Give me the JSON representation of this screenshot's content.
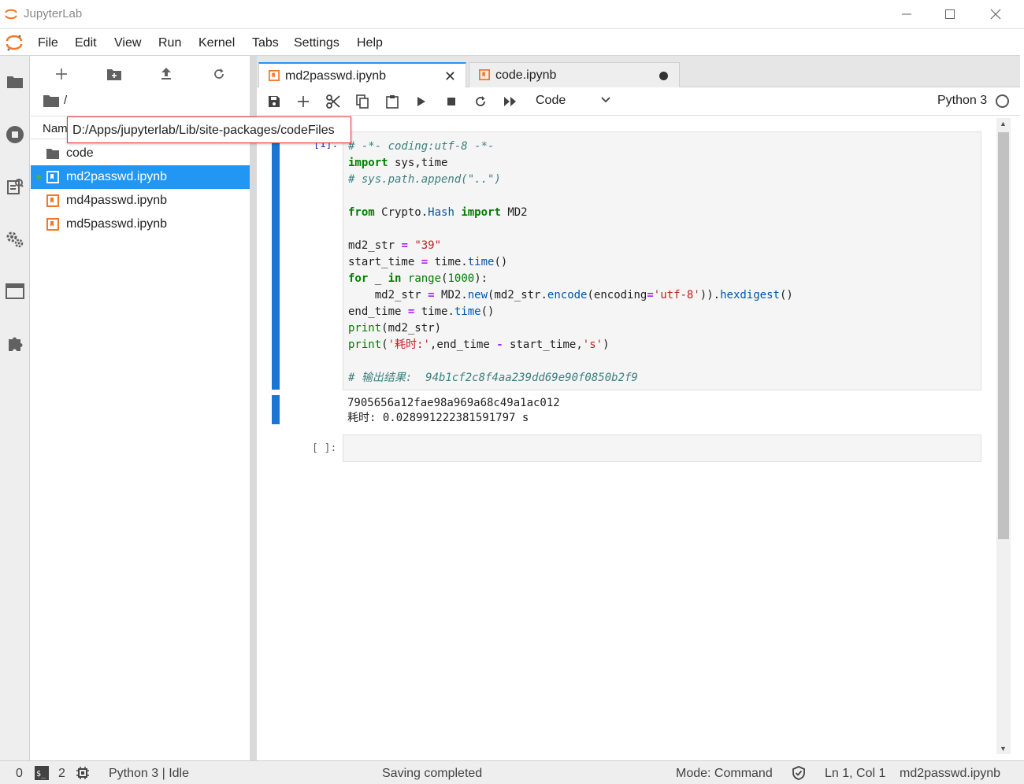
{
  "window": {
    "title": "JupyterLab",
    "minimize_icon": "minimize-icon",
    "maximize_icon": "maximize-icon",
    "close_icon": "close-icon"
  },
  "menubar": {
    "items": [
      "File",
      "Edit",
      "View",
      "Run",
      "Kernel",
      "Tabs",
      "Settings",
      "Help"
    ]
  },
  "filebrowser": {
    "breadcrumb": "/",
    "column_header": "Name",
    "tooltip_path": "D:/Apps/jupyterlab/Lib/site-packages/codeFiles",
    "files": [
      {
        "name": "code",
        "type": "folder",
        "selected": false,
        "running": false
      },
      {
        "name": "md2passwd.ipynb",
        "type": "notebook",
        "selected": true,
        "running": true
      },
      {
        "name": "md4passwd.ipynb",
        "type": "notebook",
        "selected": false,
        "running": false
      },
      {
        "name": "md5passwd.ipynb",
        "type": "notebook",
        "selected": false,
        "running": false
      }
    ]
  },
  "tabs": [
    {
      "label": "md2passwd.ipynb",
      "active": true
    },
    {
      "label": "code.ipynb",
      "active": false
    }
  ],
  "toolbar": {
    "cell_type": "Code",
    "kernel_name": "Python 3"
  },
  "cells": {
    "cell1_prompt": "[1]:",
    "cell2_prompt": "[ ]:",
    "output_line1": "7905656a12fae98a969a68c49a1ac012",
    "output_line2": "耗时: 0.028991222381591797 s"
  },
  "statusbar": {
    "terminals": "0",
    "kernels": "2",
    "kernel_status": "Python 3 | Idle",
    "message": "Saving completed",
    "mode": "Mode: Command",
    "position": "Ln 1, Col 1",
    "filename": "md2passwd.ipynb"
  },
  "colors": {
    "accent": "#2196f3",
    "jupyter_orange": "#f37726",
    "tooltip_border": "#e53935"
  }
}
